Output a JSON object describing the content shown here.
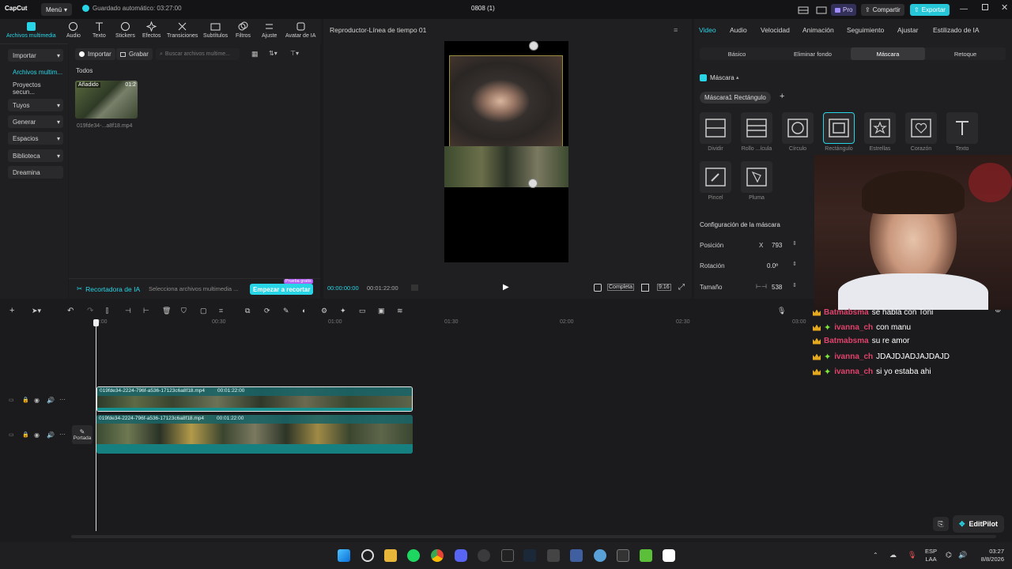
{
  "app": {
    "logo": "CapCut",
    "menu_label": "Menú",
    "autosave": "Guardado automático: 03:27:00",
    "doc_title": "0808 (1)",
    "pro_label": "Pro",
    "share_label": "Compartir",
    "export_label": "Exportar",
    "accent": "#28d5e6"
  },
  "toolbar": {
    "items": [
      "Archivos multimedia",
      "Audio",
      "Texto",
      "Stickers",
      "Efectos",
      "Transiciones",
      "Subtítulos",
      "Filtros",
      "Ajuste",
      "Avatar de IA"
    ]
  },
  "leftnav": {
    "items": [
      "Importar",
      "Archivos multim...",
      "Proyectos secun...",
      "Tuyos",
      "Generar",
      "Espacios",
      "Biblioteca",
      "Dreamina"
    ]
  },
  "media": {
    "import_label": "Importar",
    "record_label": "Grabar",
    "search_placeholder": "Buscar archivos multime...",
    "section": "Todos",
    "clip_badge": "Añadido",
    "clip_duration": "01:2",
    "clip_name": "019fde34-...a8f18.mp4",
    "ai_label": "Recortadora de IA",
    "ai_hint": "Selecciona archivos multimedia ...",
    "ai_button": "Empezar a recortar",
    "ai_badge": "Prueba gratis"
  },
  "player": {
    "title": "Reproductor-Línea de tiempo 01",
    "time_current": "00:00:00:00",
    "time_total": "00:01:22:00",
    "quality": "Completa",
    "ratio": "9:16"
  },
  "rpanel": {
    "tabs": [
      "Video",
      "Audio",
      "Velocidad",
      "Animación",
      "Seguimiento",
      "Ajustar",
      "Estilizado de IA"
    ],
    "subtabs": [
      "Básico",
      "Eliminar fondo",
      "Máscara",
      "Retoque"
    ],
    "mask_title": "Máscara",
    "mask_chip": "Máscara1 Rectángulo",
    "shapes": [
      "Dividir",
      "Rollo ...ícula",
      "Círculo",
      "Rectángulo",
      "Estrellas",
      "Corazón",
      "Texto"
    ],
    "shapes2": [
      "Pincel",
      "Pluma"
    ],
    "config_title": "Configuración de la máscara",
    "position_label": "Posición",
    "position_axis": "X",
    "position_x": "793",
    "rotation_label": "Rotación",
    "rotation_value": "0.0º",
    "size_label": "Tamaño",
    "size_value": "538"
  },
  "timeline": {
    "ticks": [
      "00:00",
      "00:30",
      "01:00",
      "01:30",
      "02:00",
      "02:30",
      "03:00"
    ],
    "clip1_name": "019fde34-2224-796f-a536-17123c6a8f18.mp4",
    "clip1_duration": "00:01:22:00",
    "clip2_name": "019fde34-2224-796f-a536-17123c6a8f18.mp4",
    "clip2_duration": "00:01:22:00",
    "cover_label": "Portada"
  },
  "chat": [
    {
      "user": "Batmabsma",
      "text": "se habla con Toni",
      "color": "#e0436b",
      "sub": false
    },
    {
      "user": "ivanna_ch",
      "text": "con manu",
      "color": "#e0436b",
      "sub": true
    },
    {
      "user": "Batmabsma",
      "text": "su re amor",
      "color": "#e0436b",
      "sub": false
    },
    {
      "user": "ivanna_ch",
      "text": "JDAJDJADJAJDAJD",
      "color": "#e0436b",
      "sub": true
    },
    {
      "user": "ivanna_ch",
      "text": "si yo estaba ahi",
      "color": "#e0436b",
      "sub": true
    }
  ],
  "editpilot": "EditPilot",
  "taskbar": {
    "lang1": "ESP",
    "lang2": "LAA",
    "time": "03:27",
    "date": "8/8/2026"
  }
}
